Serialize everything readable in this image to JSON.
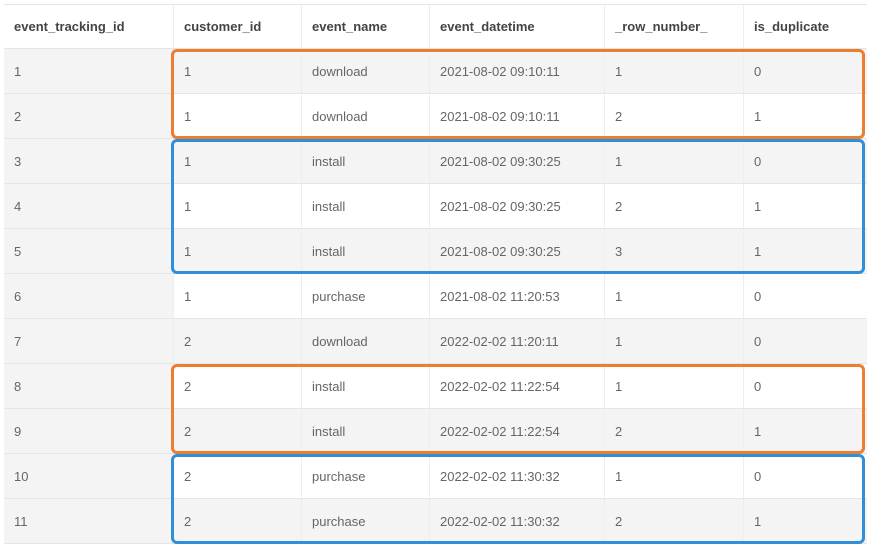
{
  "columns": [
    "event_tracking_id",
    "customer_id",
    "event_name",
    "event_datetime",
    "_row_number_",
    "is_duplicate"
  ],
  "rows": [
    {
      "shade": true,
      "cells": [
        "1",
        "1",
        "download",
        "2021-08-02 09:10:11",
        "1",
        "0"
      ]
    },
    {
      "shade": false,
      "cells": [
        "2",
        "1",
        "download",
        "2021-08-02 09:10:11",
        "2",
        "1"
      ]
    },
    {
      "shade": true,
      "cells": [
        "3",
        "1",
        "install",
        "2021-08-02 09:30:25",
        "1",
        "0"
      ]
    },
    {
      "shade": false,
      "cells": [
        "4",
        "1",
        "install",
        "2021-08-02 09:30:25",
        "2",
        "1"
      ]
    },
    {
      "shade": true,
      "cells": [
        "5",
        "1",
        "install",
        "2021-08-02 09:30:25",
        "3",
        "1"
      ]
    },
    {
      "shade": false,
      "cells": [
        "6",
        "1",
        "purchase",
        "2021-08-02 11:20:53",
        "1",
        "0"
      ]
    },
    {
      "shade": true,
      "cells": [
        "7",
        "2",
        "download",
        "2022-02-02 11:20:11",
        "1",
        "0"
      ]
    },
    {
      "shade": false,
      "cells": [
        "8",
        "2",
        "install",
        "2022-02-02 11:22:54",
        "1",
        "0"
      ]
    },
    {
      "shade": true,
      "cells": [
        "9",
        "2",
        "install",
        "2022-02-02 11:22:54",
        "2",
        "1"
      ]
    },
    {
      "shade": false,
      "cells": [
        "10",
        "2",
        "purchase",
        "2022-02-02 11:30:32",
        "1",
        "0"
      ]
    },
    {
      "shade": true,
      "cells": [
        "11",
        "2",
        "purchase",
        "2022-02-02 11:30:32",
        "2",
        "1"
      ]
    }
  ],
  "highlights": [
    {
      "class": "orange b1"
    },
    {
      "class": "blue b2"
    },
    {
      "class": "orange b3"
    },
    {
      "class": "blue b4"
    }
  ]
}
